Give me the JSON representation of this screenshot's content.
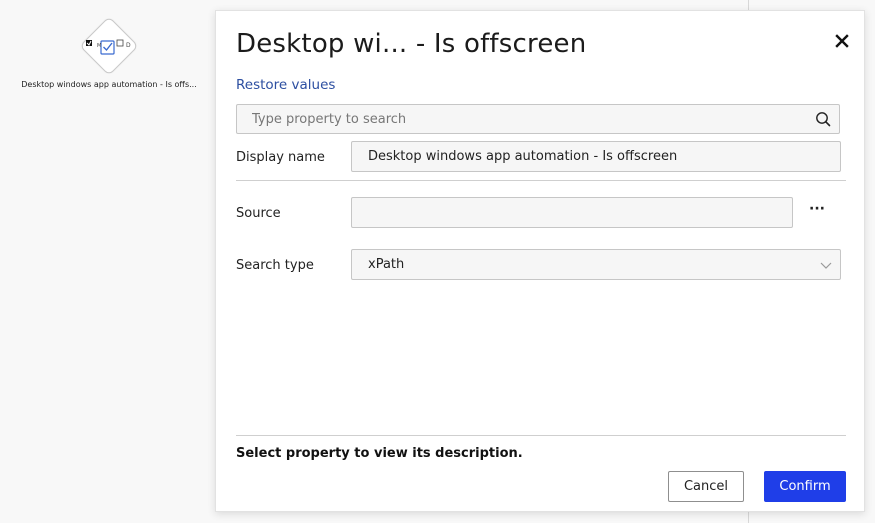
{
  "canvas": {
    "node_label": "Desktop windows app automation - Is offs..."
  },
  "dialog": {
    "title": "Desktop wi... - Is offscreen",
    "restore_link": "Restore values",
    "search": {
      "placeholder": "Type property to search",
      "value": ""
    },
    "display_name": {
      "label": "Display name",
      "value": "Desktop windows app automation - Is offscreen"
    },
    "source": {
      "label": "Source",
      "value": "",
      "browse_label": "···"
    },
    "search_type": {
      "label": "Search type",
      "value": "xPath"
    },
    "description_hint": "Select property to view its description.",
    "buttons": {
      "cancel": "Cancel",
      "confirm": "Confirm"
    }
  },
  "colors": {
    "accent": "#1f3ee8",
    "link": "#2d4fa1",
    "field_bg": "#f6f6f6",
    "field_border": "#c6c6c6"
  },
  "icons": [
    "checkbox-diamond-icon",
    "close-icon",
    "search-icon",
    "ellipsis-icon",
    "chevron-down-icon"
  ]
}
